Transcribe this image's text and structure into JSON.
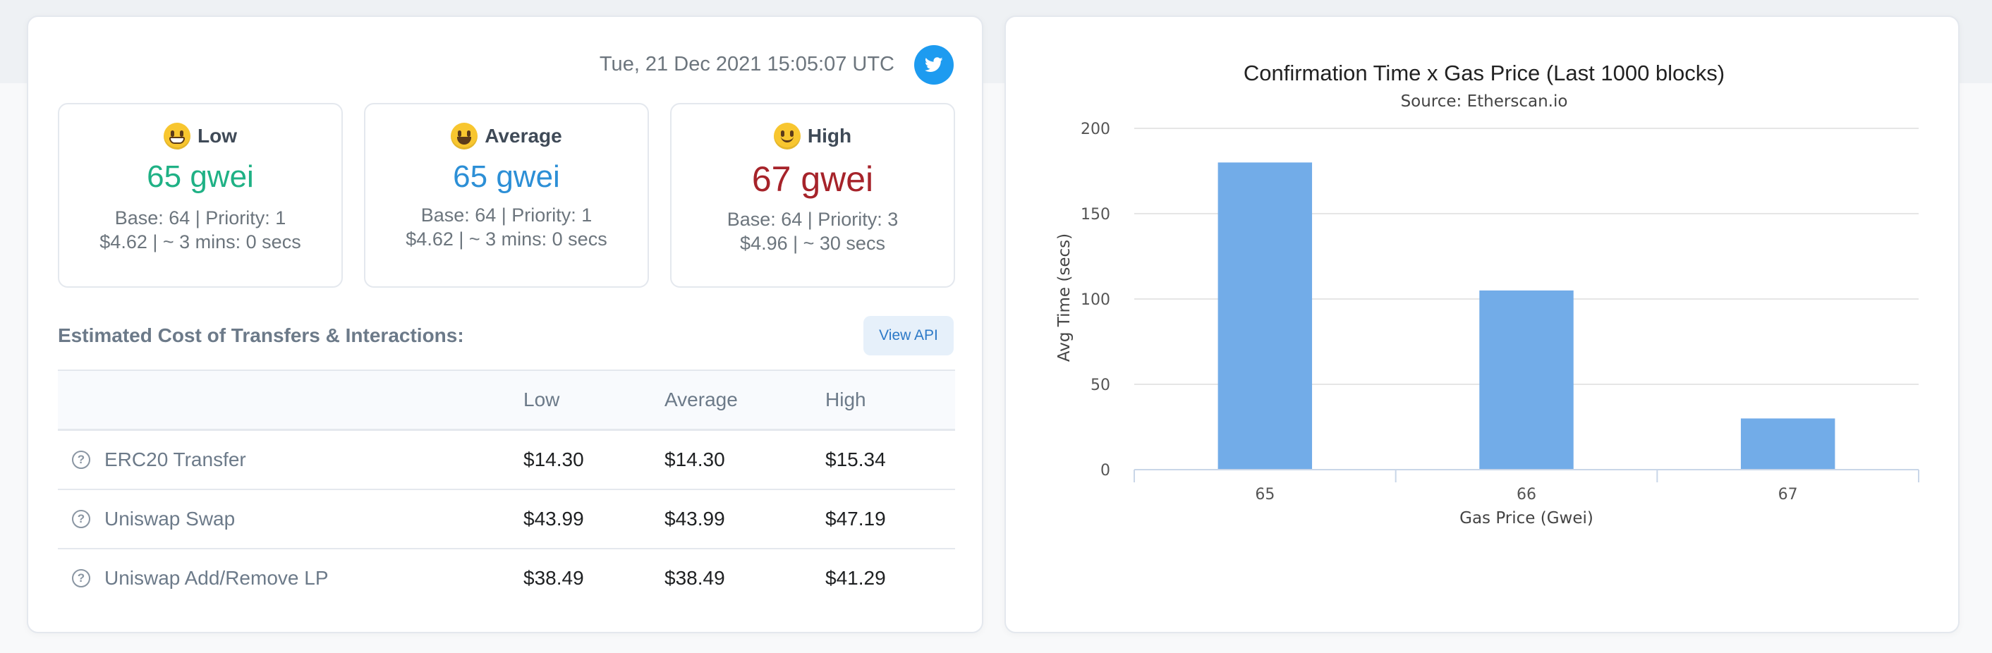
{
  "header": {
    "timestamp": "Tue, 21 Dec 2021 15:05:07 UTC",
    "twitter_icon": "twitter-icon"
  },
  "gas_tiers": [
    {
      "label": "Low",
      "value": "65 gwei",
      "line1": "Base: 64 | Priority: 1",
      "line2": "$4.62 | ~ 3 mins: 0 secs",
      "color": "#1fb185",
      "emoji": "grinning-face"
    },
    {
      "label": "Average",
      "value": "65 gwei",
      "line1": "Base: 64 | Priority: 1",
      "line2": "$4.62 | ~ 3 mins: 0 secs",
      "color": "#2c8fd6",
      "emoji": "grinning-face-big-eyes"
    },
    {
      "label": "High",
      "value": "67 gwei",
      "line1": "Base: 64 | Priority: 3",
      "line2": "$4.96 | ~ 30 secs",
      "color": "#a6232a",
      "emoji": "slightly-smiling-face"
    }
  ],
  "cost_section": {
    "title": "Estimated Cost of Transfers & Interactions:",
    "view_api_label": "View API",
    "columns": [
      "",
      "Low",
      "Average",
      "High"
    ],
    "rows": [
      {
        "name": "ERC20 Transfer",
        "low": "$14.30",
        "average": "$14.30",
        "high": "$15.34"
      },
      {
        "name": "Uniswap Swap",
        "low": "$43.99",
        "average": "$43.99",
        "high": "$47.19"
      },
      {
        "name": "Uniswap Add/Remove LP",
        "low": "$38.49",
        "average": "$38.49",
        "high": "$41.29"
      }
    ]
  },
  "chart_data": {
    "type": "bar",
    "title": "Confirmation Time x Gas Price (Last 1000 blocks)",
    "subtitle": "Source: Etherscan.io",
    "xlabel": "Gas Price (Gwei)",
    "ylabel": "Avg Time (secs)",
    "categories": [
      "65",
      "66",
      "67"
    ],
    "values": [
      180,
      105,
      30
    ],
    "ylim": [
      0,
      200
    ],
    "yticks": [
      0,
      50,
      100,
      150,
      200
    ],
    "grid": true,
    "bar_color": "#72ace8"
  }
}
